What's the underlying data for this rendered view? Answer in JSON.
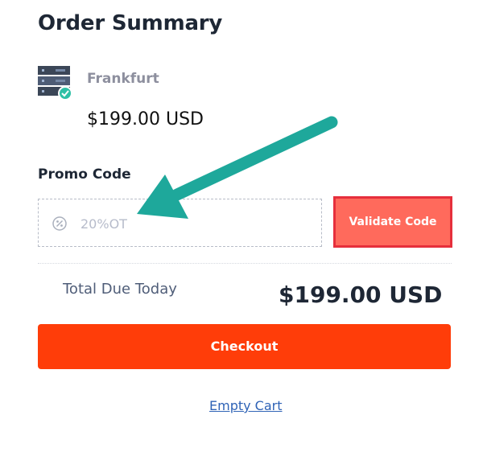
{
  "order_summary": {
    "title": "Order Summary",
    "product": {
      "name": "Frankfurt",
      "price": "$199.00 USD",
      "icon": "server-check-icon"
    }
  },
  "promo": {
    "label": "Promo Code",
    "input_value": "20%OT",
    "icon": "ticket-icon",
    "validate_label": "Validate Code"
  },
  "total": {
    "label": "Total Due Today",
    "amount": "$199.00 USD"
  },
  "checkout_label": "Checkout",
  "empty_cart_label": "Empty Cart",
  "colors": {
    "checkout_bg": "#ff3d09",
    "validate_bg": "#ff6a5c",
    "validate_border": "#e62f3c",
    "arrow": "#1ea89b",
    "link": "#2f63b6"
  }
}
